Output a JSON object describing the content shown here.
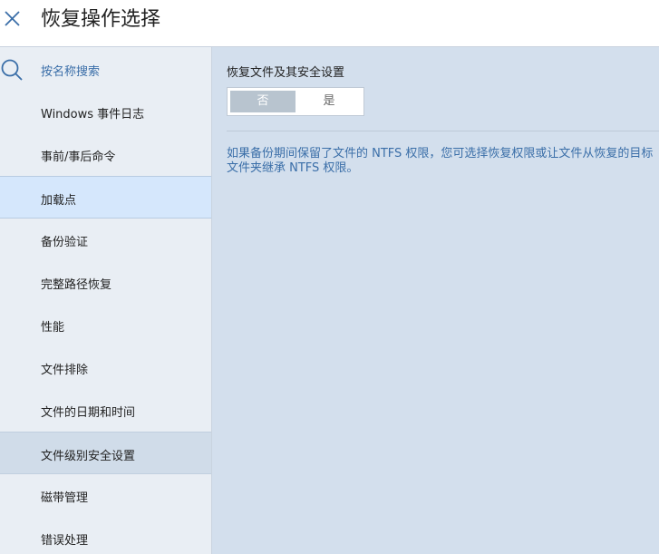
{
  "header": {
    "title": "恢复操作选择",
    "close_icon": "close-icon"
  },
  "sidebar": {
    "search": {
      "icon": "search-icon",
      "label": "按名称搜索"
    },
    "items": [
      {
        "label": "Windows 事件日志",
        "state": "normal"
      },
      {
        "label": "事前/事后命令",
        "state": "normal"
      },
      {
        "label": "加载点",
        "state": "active"
      },
      {
        "label": "备份验证",
        "state": "normal"
      },
      {
        "label": "完整路径恢复",
        "state": "normal"
      },
      {
        "label": "性能",
        "state": "normal"
      },
      {
        "label": "文件排除",
        "state": "normal"
      },
      {
        "label": "文件的日期和时间",
        "state": "normal"
      },
      {
        "label": "文件级别安全设置",
        "state": "hovered"
      },
      {
        "label": "磁带管理",
        "state": "normal"
      },
      {
        "label": "错误处理",
        "state": "normal"
      }
    ]
  },
  "main": {
    "setting_title": "恢复文件及其安全设置",
    "toggle": {
      "no_label": "否",
      "yes_label": "是",
      "selected": "否"
    },
    "description": "如果备份期间保留了文件的 NTFS 权限，您可选择恢复权限或让文件从恢复的目标文件夹继承 NTFS 权限。"
  },
  "colors": {
    "accent_blue": "#3a6ea8",
    "sidebar_bg": "#e9eef4",
    "main_bg": "#d3dfed",
    "active_item_bg": "#d5e7fc",
    "hovered_item_bg": "#d0dce9",
    "toggle_selected_bg": "#b8c4cf"
  }
}
